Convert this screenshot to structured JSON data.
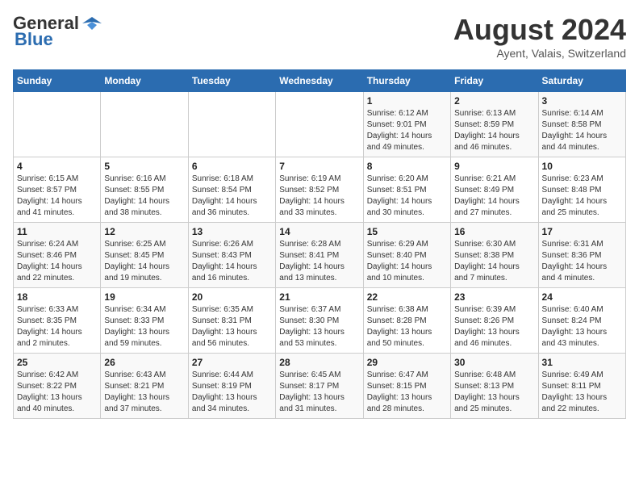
{
  "header": {
    "logo_line1": "General",
    "logo_line2": "Blue",
    "title": "August 2024",
    "subtitle": "Ayent, Valais, Switzerland"
  },
  "weekdays": [
    "Sunday",
    "Monday",
    "Tuesday",
    "Wednesday",
    "Thursday",
    "Friday",
    "Saturday"
  ],
  "weeks": [
    [
      {
        "day": "",
        "info": ""
      },
      {
        "day": "",
        "info": ""
      },
      {
        "day": "",
        "info": ""
      },
      {
        "day": "",
        "info": ""
      },
      {
        "day": "1",
        "info": "Sunrise: 6:12 AM\nSunset: 9:01 PM\nDaylight: 14 hours and 49 minutes."
      },
      {
        "day": "2",
        "info": "Sunrise: 6:13 AM\nSunset: 8:59 PM\nDaylight: 14 hours and 46 minutes."
      },
      {
        "day": "3",
        "info": "Sunrise: 6:14 AM\nSunset: 8:58 PM\nDaylight: 14 hours and 44 minutes."
      }
    ],
    [
      {
        "day": "4",
        "info": "Sunrise: 6:15 AM\nSunset: 8:57 PM\nDaylight: 14 hours and 41 minutes."
      },
      {
        "day": "5",
        "info": "Sunrise: 6:16 AM\nSunset: 8:55 PM\nDaylight: 14 hours and 38 minutes."
      },
      {
        "day": "6",
        "info": "Sunrise: 6:18 AM\nSunset: 8:54 PM\nDaylight: 14 hours and 36 minutes."
      },
      {
        "day": "7",
        "info": "Sunrise: 6:19 AM\nSunset: 8:52 PM\nDaylight: 14 hours and 33 minutes."
      },
      {
        "day": "8",
        "info": "Sunrise: 6:20 AM\nSunset: 8:51 PM\nDaylight: 14 hours and 30 minutes."
      },
      {
        "day": "9",
        "info": "Sunrise: 6:21 AM\nSunset: 8:49 PM\nDaylight: 14 hours and 27 minutes."
      },
      {
        "day": "10",
        "info": "Sunrise: 6:23 AM\nSunset: 8:48 PM\nDaylight: 14 hours and 25 minutes."
      }
    ],
    [
      {
        "day": "11",
        "info": "Sunrise: 6:24 AM\nSunset: 8:46 PM\nDaylight: 14 hours and 22 minutes."
      },
      {
        "day": "12",
        "info": "Sunrise: 6:25 AM\nSunset: 8:45 PM\nDaylight: 14 hours and 19 minutes."
      },
      {
        "day": "13",
        "info": "Sunrise: 6:26 AM\nSunset: 8:43 PM\nDaylight: 14 hours and 16 minutes."
      },
      {
        "day": "14",
        "info": "Sunrise: 6:28 AM\nSunset: 8:41 PM\nDaylight: 14 hours and 13 minutes."
      },
      {
        "day": "15",
        "info": "Sunrise: 6:29 AM\nSunset: 8:40 PM\nDaylight: 14 hours and 10 minutes."
      },
      {
        "day": "16",
        "info": "Sunrise: 6:30 AM\nSunset: 8:38 PM\nDaylight: 14 hours and 7 minutes."
      },
      {
        "day": "17",
        "info": "Sunrise: 6:31 AM\nSunset: 8:36 PM\nDaylight: 14 hours and 4 minutes."
      }
    ],
    [
      {
        "day": "18",
        "info": "Sunrise: 6:33 AM\nSunset: 8:35 PM\nDaylight: 14 hours and 2 minutes."
      },
      {
        "day": "19",
        "info": "Sunrise: 6:34 AM\nSunset: 8:33 PM\nDaylight: 13 hours and 59 minutes."
      },
      {
        "day": "20",
        "info": "Sunrise: 6:35 AM\nSunset: 8:31 PM\nDaylight: 13 hours and 56 minutes."
      },
      {
        "day": "21",
        "info": "Sunrise: 6:37 AM\nSunset: 8:30 PM\nDaylight: 13 hours and 53 minutes."
      },
      {
        "day": "22",
        "info": "Sunrise: 6:38 AM\nSunset: 8:28 PM\nDaylight: 13 hours and 50 minutes."
      },
      {
        "day": "23",
        "info": "Sunrise: 6:39 AM\nSunset: 8:26 PM\nDaylight: 13 hours and 46 minutes."
      },
      {
        "day": "24",
        "info": "Sunrise: 6:40 AM\nSunset: 8:24 PM\nDaylight: 13 hours and 43 minutes."
      }
    ],
    [
      {
        "day": "25",
        "info": "Sunrise: 6:42 AM\nSunset: 8:22 PM\nDaylight: 13 hours and 40 minutes."
      },
      {
        "day": "26",
        "info": "Sunrise: 6:43 AM\nSunset: 8:21 PM\nDaylight: 13 hours and 37 minutes."
      },
      {
        "day": "27",
        "info": "Sunrise: 6:44 AM\nSunset: 8:19 PM\nDaylight: 13 hours and 34 minutes."
      },
      {
        "day": "28",
        "info": "Sunrise: 6:45 AM\nSunset: 8:17 PM\nDaylight: 13 hours and 31 minutes."
      },
      {
        "day": "29",
        "info": "Sunrise: 6:47 AM\nSunset: 8:15 PM\nDaylight: 13 hours and 28 minutes."
      },
      {
        "day": "30",
        "info": "Sunrise: 6:48 AM\nSunset: 8:13 PM\nDaylight: 13 hours and 25 minutes."
      },
      {
        "day": "31",
        "info": "Sunrise: 6:49 AM\nSunset: 8:11 PM\nDaylight: 13 hours and 22 minutes."
      }
    ]
  ]
}
